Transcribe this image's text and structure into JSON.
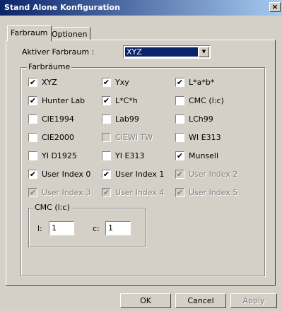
{
  "window": {
    "title": "Stand Alone Konfiguration",
    "close_label": "×"
  },
  "tabs": [
    {
      "label": "Farbraum",
      "active": true
    },
    {
      "label": "Optionen",
      "active": false
    }
  ],
  "active_space": {
    "label": "Aktiver Farbraum :",
    "value": "XYZ"
  },
  "colorspaces": {
    "legend": "Farbräume",
    "items": [
      {
        "label": "XYZ",
        "checked": true,
        "enabled": true
      },
      {
        "label": "Yxy",
        "checked": true,
        "enabled": true
      },
      {
        "label": "L*a*b*",
        "checked": true,
        "enabled": true
      },
      {
        "label": "Hunter Lab",
        "checked": true,
        "enabled": true
      },
      {
        "label": "L*C*h",
        "checked": true,
        "enabled": true
      },
      {
        "label": "CMC (l:c)",
        "checked": false,
        "enabled": true
      },
      {
        "label": "CIE1994",
        "checked": false,
        "enabled": true
      },
      {
        "label": "Lab99",
        "checked": false,
        "enabled": true
      },
      {
        "label": "LCh99",
        "checked": false,
        "enabled": true
      },
      {
        "label": "CIE2000",
        "checked": false,
        "enabled": true
      },
      {
        "label": "CIEWI TW",
        "checked": false,
        "enabled": false
      },
      {
        "label": "WI E313",
        "checked": false,
        "enabled": true
      },
      {
        "label": "YI D1925",
        "checked": false,
        "enabled": true
      },
      {
        "label": "YI E313",
        "checked": false,
        "enabled": true
      },
      {
        "label": "Munsell",
        "checked": true,
        "enabled": true
      },
      {
        "label": "User Index 0",
        "checked": true,
        "enabled": true
      },
      {
        "label": "User Index 1",
        "checked": true,
        "enabled": true
      },
      {
        "label": "User Index 2",
        "checked": true,
        "enabled": false
      },
      {
        "label": "User Index 3",
        "checked": true,
        "enabled": false
      },
      {
        "label": "User Index 4",
        "checked": true,
        "enabled": false
      },
      {
        "label": "User Index 5",
        "checked": true,
        "enabled": false
      }
    ]
  },
  "cmc": {
    "legend": "CMC (l:c)",
    "l_label": "l:",
    "l_value": "1",
    "c_label": "c:",
    "c_value": "1"
  },
  "buttons": {
    "ok": "OK",
    "cancel": "Cancel",
    "apply": "Apply"
  }
}
